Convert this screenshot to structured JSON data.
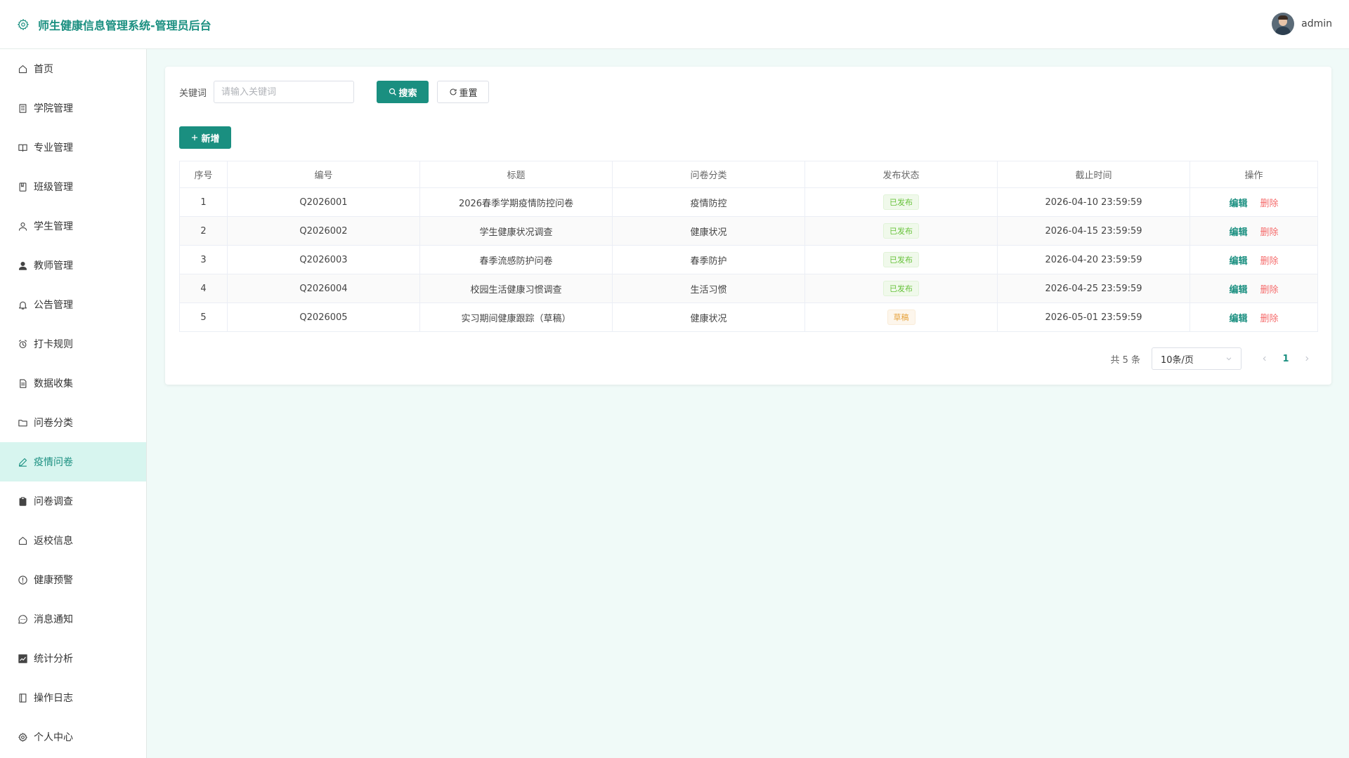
{
  "header": {
    "title": "师生健康信息管理系统-管理员后台",
    "username": "admin"
  },
  "sidebar": {
    "items": [
      {
        "label": "首页",
        "icon": "home-icon"
      },
      {
        "label": "学院管理",
        "icon": "building-icon"
      },
      {
        "label": "专业管理",
        "icon": "book-icon"
      },
      {
        "label": "班级管理",
        "icon": "notebook-icon"
      },
      {
        "label": "学生管理",
        "icon": "user-icon"
      },
      {
        "label": "教师管理",
        "icon": "user-solid-icon"
      },
      {
        "label": "公告管理",
        "icon": "bell-icon"
      },
      {
        "label": "打卡规则",
        "icon": "alarm-clock-icon"
      },
      {
        "label": "数据收集",
        "icon": "document-icon"
      },
      {
        "label": "问卷分类",
        "icon": "folder-icon"
      },
      {
        "label": "疫情问卷",
        "icon": "edit-icon",
        "active": true
      },
      {
        "label": "问卷调查",
        "icon": "clipboard-icon"
      },
      {
        "label": "返校信息",
        "icon": "house-icon"
      },
      {
        "label": "健康预警",
        "icon": "warning-icon"
      },
      {
        "label": "消息通知",
        "icon": "chat-icon"
      },
      {
        "label": "统计分析",
        "icon": "chart-icon"
      },
      {
        "label": "操作日志",
        "icon": "log-book-icon"
      },
      {
        "label": "个人中心",
        "icon": "settings-icon"
      }
    ]
  },
  "search": {
    "label": "关键词",
    "placeholder": "请输入关键词",
    "value": "",
    "search_label": "搜索",
    "reset_label": "重置"
  },
  "toolbar": {
    "add_label": "新增"
  },
  "table": {
    "columns": [
      "序号",
      "编号",
      "标题",
      "问卷分类",
      "发布状态",
      "截止时间",
      "操作"
    ],
    "rows": [
      {
        "index": "1",
        "code": "Q2026001",
        "title": "2026春季学期疫情防控问卷",
        "category": "疫情防控",
        "status": "已发布",
        "status_type": "published",
        "deadline": "2026-04-10 23:59:59"
      },
      {
        "index": "2",
        "code": "Q2026002",
        "title": "学生健康状况调查",
        "category": "健康状况",
        "status": "已发布",
        "status_type": "published",
        "deadline": "2026-04-15 23:59:59"
      },
      {
        "index": "3",
        "code": "Q2026003",
        "title": "春季流感防护问卷",
        "category": "春季防护",
        "status": "已发布",
        "status_type": "published",
        "deadline": "2026-04-20 23:59:59"
      },
      {
        "index": "4",
        "code": "Q2026004",
        "title": "校园生活健康习惯调查",
        "category": "生活习惯",
        "status": "已发布",
        "status_type": "published",
        "deadline": "2026-04-25 23:59:59"
      },
      {
        "index": "5",
        "code": "Q2026005",
        "title": "实习期间健康跟踪（草稿）",
        "category": "健康状况",
        "status": "草稿",
        "status_type": "draft",
        "deadline": "2026-05-01 23:59:59"
      }
    ],
    "edit_label": "编辑",
    "delete_label": "删除"
  },
  "pagination": {
    "total_text": "共 5 条",
    "page_size": "10条/页",
    "current_page": "1"
  },
  "colors": {
    "accent": "#1a8f80",
    "active_bg": "#d7f5ef",
    "danger": "#f56c6c",
    "published": "#67c23a",
    "draft": "#e6a23c"
  }
}
